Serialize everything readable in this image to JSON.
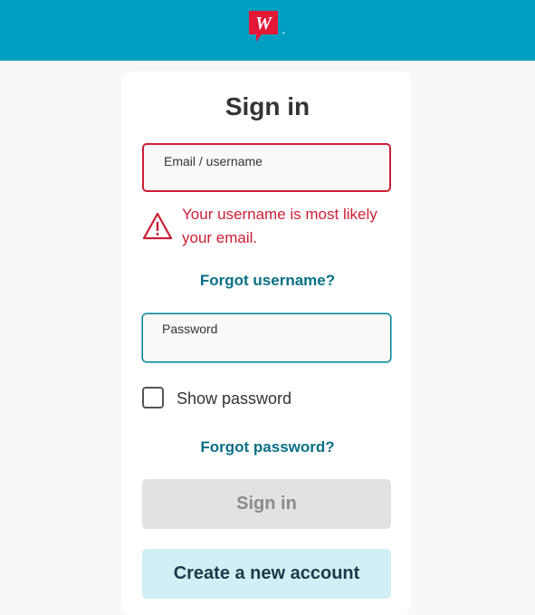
{
  "header": {
    "logo_letter": "W",
    "logo_alt": "Walgreens logo"
  },
  "form": {
    "title": "Sign in",
    "email_label": "Email / username",
    "email_value": "",
    "error_message": "Your username is most likely your email.",
    "forgot_username": "Forgot username?",
    "password_label": "Password",
    "password_value": "",
    "show_password_label": "Show password",
    "show_password_checked": false,
    "forgot_password": "Forgot password?",
    "signin_button": "Sign in",
    "create_account_button": "Create a new account"
  },
  "colors": {
    "header_bg": "#009fc1",
    "page_bg": "#f9f8f6",
    "error": "#cc1f36",
    "link": "#0a6f86",
    "logo_red": "#e31837"
  }
}
